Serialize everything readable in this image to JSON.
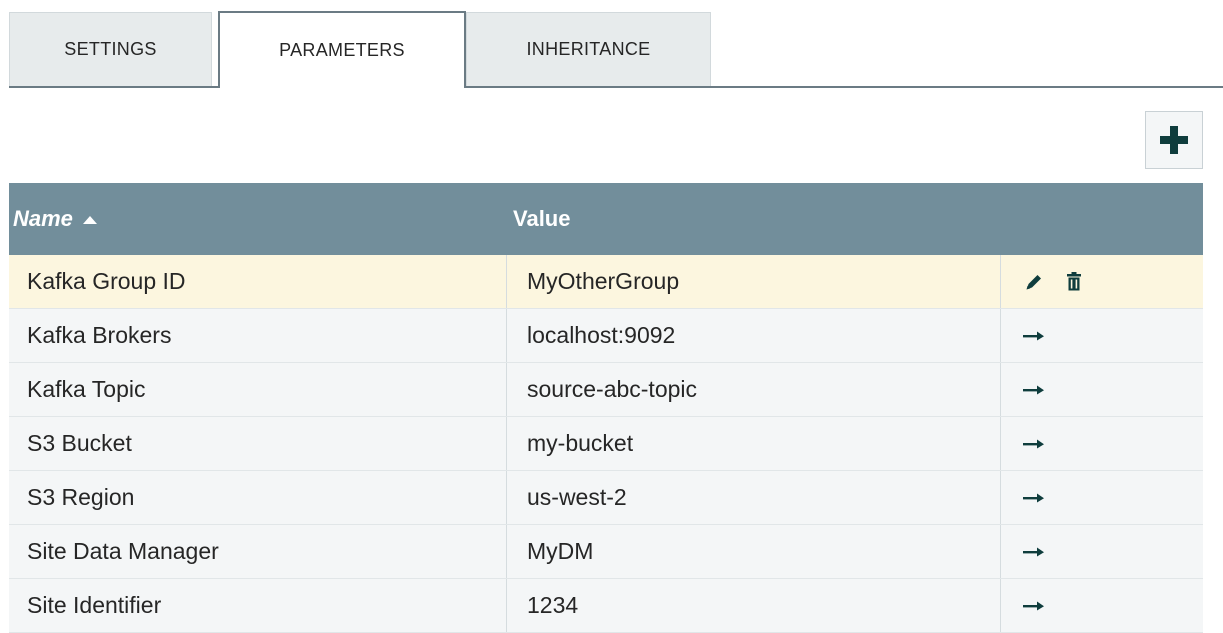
{
  "tabs": [
    {
      "label": "SETTINGS",
      "active": false
    },
    {
      "label": "PARAMETERS",
      "active": true
    },
    {
      "label": "INHERITANCE",
      "active": false
    }
  ],
  "toolbar": {
    "add_icon": "plus-icon"
  },
  "table": {
    "columns": {
      "name": "Name",
      "value": "Value"
    },
    "sort": {
      "column": "name",
      "direction": "ascending"
    },
    "rows": [
      {
        "name": "Kafka Group ID",
        "value": "MyOtherGroup",
        "selected": true,
        "actions": [
          "edit-icon",
          "delete-icon"
        ]
      },
      {
        "name": "Kafka Brokers",
        "value": "localhost:9092",
        "selected": false,
        "actions": [
          "goto-arrow-icon"
        ]
      },
      {
        "name": "Kafka Topic",
        "value": "source-abc-topic",
        "selected": false,
        "actions": [
          "goto-arrow-icon"
        ]
      },
      {
        "name": "S3 Bucket",
        "value": "my-bucket",
        "selected": false,
        "actions": [
          "goto-arrow-icon"
        ]
      },
      {
        "name": "S3 Region",
        "value": "us-west-2",
        "selected": false,
        "actions": [
          "goto-arrow-icon"
        ]
      },
      {
        "name": "Site Data Manager",
        "value": "MyDM",
        "selected": false,
        "actions": [
          "goto-arrow-icon"
        ]
      },
      {
        "name": "Site Identifier",
        "value": "1234",
        "selected": false,
        "actions": [
          "goto-arrow-icon"
        ]
      }
    ]
  },
  "colors": {
    "header_bg": "#728e9b",
    "selected_row_bg": "#fcf6df",
    "row_bg": "#f4f6f7",
    "icon_color": "#0f3d3d"
  }
}
